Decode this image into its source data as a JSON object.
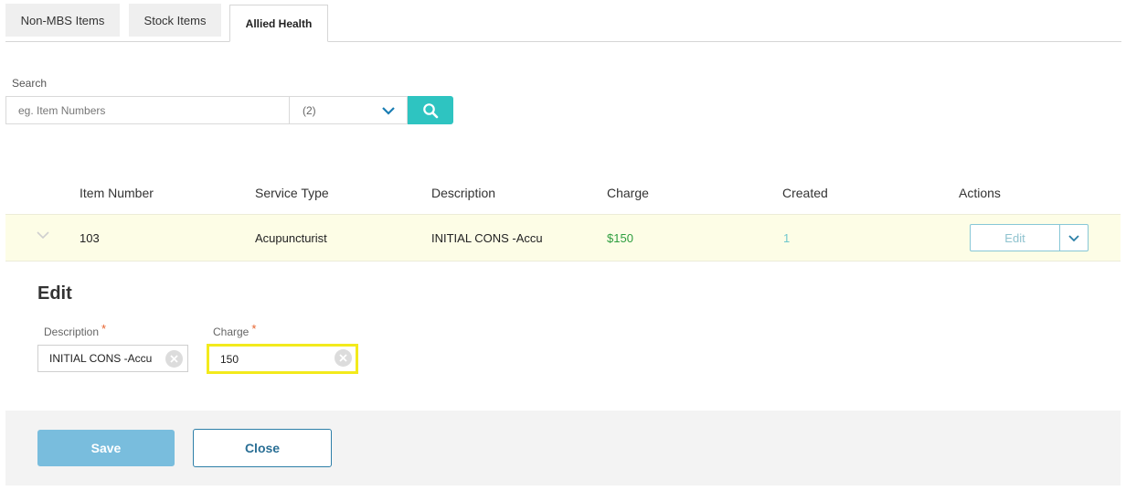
{
  "tabs": [
    {
      "label": "Non-MBS Items"
    },
    {
      "label": "Stock Items"
    },
    {
      "label": "Allied Health"
    }
  ],
  "search": {
    "label": "Search",
    "placeholder": "eg. Item Numbers",
    "value": "",
    "filter_value": "(2)"
  },
  "table": {
    "columns": [
      "Item Number",
      "Service Type",
      "Description",
      "Charge",
      "Created",
      "Actions"
    ],
    "rows": [
      {
        "item_number": "103",
        "service_type": "Acupuncturist",
        "description": "INITIAL CONS -Accu",
        "charge": "$150",
        "created": "1",
        "action_label": "Edit"
      }
    ]
  },
  "edit_form": {
    "title": "Edit",
    "description_label": "Description",
    "description_value": "INITIAL CONS -Accu",
    "charge_label": "Charge",
    "charge_value": "150",
    "required_mark": "*",
    "save_label": "Save",
    "close_label": "Close"
  },
  "colors": {
    "accent_teal": "#2ec4c1",
    "charge_green": "#2e9e3f",
    "save_blue": "#79bddd",
    "highlight_yellow": "#f3ea1c",
    "required_orange": "#e7632f"
  },
  "icons": {
    "search": "search-icon",
    "chevron": "chevron-down-icon",
    "clear": "clear-circle-icon"
  }
}
